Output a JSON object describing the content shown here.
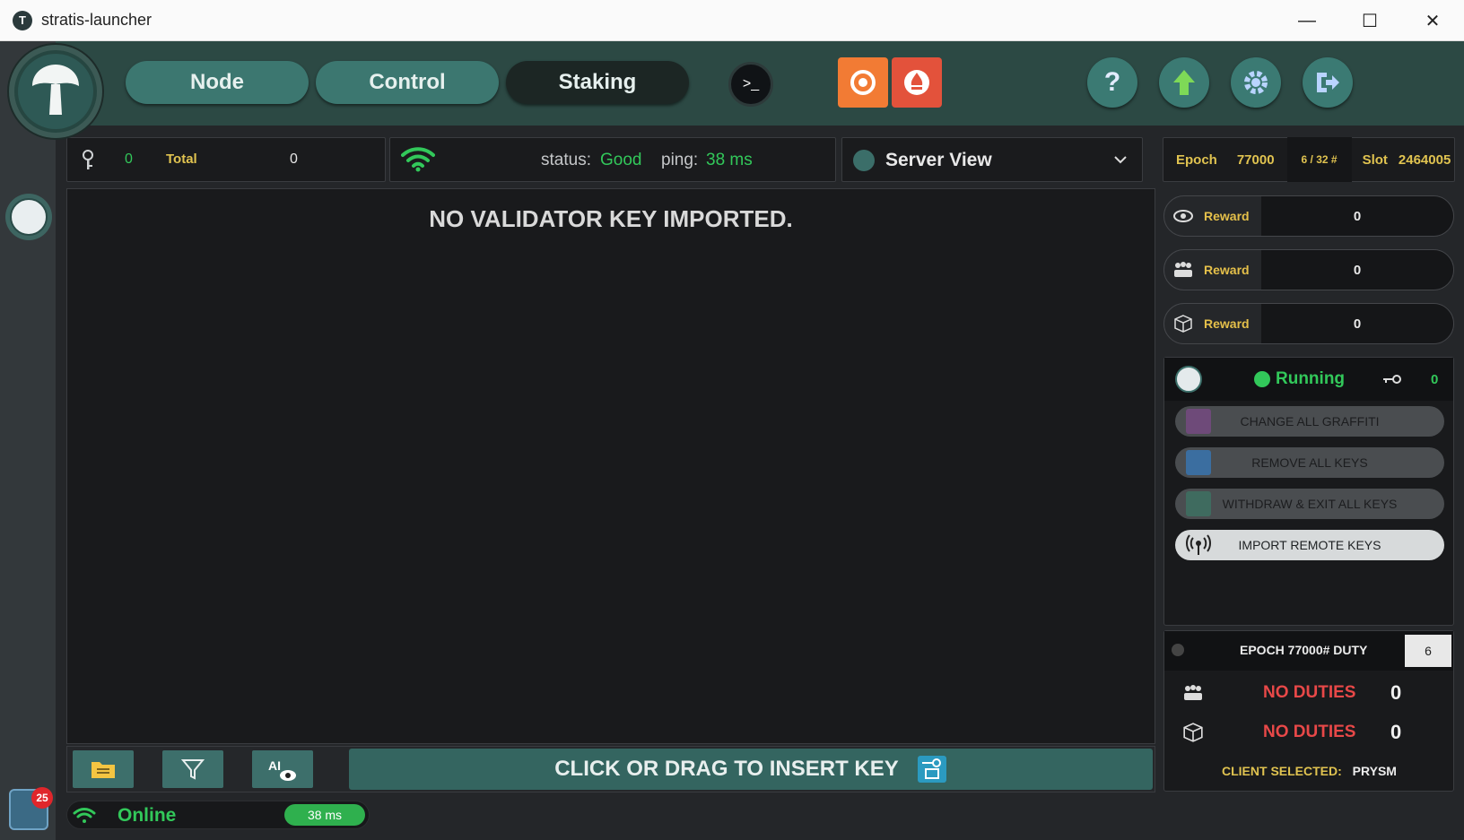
{
  "window": {
    "title": "stratis-launcher",
    "minimize": "—",
    "maximize": "☐",
    "close": "✕"
  },
  "nav": {
    "node": "Node",
    "control": "Control",
    "staking": "Staking",
    "terminal": ">_",
    "help": "?"
  },
  "keys_bar": {
    "count": "0",
    "total_label": "Total",
    "total_value": "0"
  },
  "network_bar": {
    "status_label": "status:",
    "status_value": "Good",
    "ping_label": "ping:",
    "ping_value": "38 ms"
  },
  "server_view": {
    "label": "Server View"
  },
  "main": {
    "empty_message": "NO VALIDATOR KEY IMPORTED.",
    "insert_label": "CLICK OR DRAG TO INSERT KEY"
  },
  "footer": {
    "status": "Online",
    "ping": "38 ms",
    "notifications": "25"
  },
  "epoch": {
    "epoch_label": "Epoch",
    "epoch_value": "77000",
    "slot_progress": "6 / 32 #",
    "slot_label": "Slot",
    "slot_value": "2464005"
  },
  "rewards": [
    {
      "label": "Reward",
      "value": "0",
      "icon": "eye-icon"
    },
    {
      "label": "Reward",
      "value": "0",
      "icon": "group-icon"
    },
    {
      "label": "Reward",
      "value": "0",
      "icon": "cube-icon"
    }
  ],
  "validator": {
    "status": "Running",
    "key_count": "0",
    "buttons": [
      "CHANGE ALL GRAFFITI",
      "REMOVE ALL KEYS",
      "WITHDRAW & EXIT ALL KEYS",
      "IMPORT REMOTE KEYS"
    ]
  },
  "duties": {
    "title": "EPOCH 77000# DUTY",
    "count": "6",
    "rows": [
      {
        "text": "NO DUTIES",
        "value": "0",
        "icon": "group-icon"
      },
      {
        "text": "NO DUTIES",
        "value": "0",
        "icon": "cube-icon"
      }
    ],
    "client_label": "CLIENT SELECTED:",
    "client_value": "PRYSM"
  },
  "colors": {
    "accent": "#3c7770",
    "good": "#32c85a",
    "warn": "#e0c350",
    "danger": "#e84848"
  }
}
